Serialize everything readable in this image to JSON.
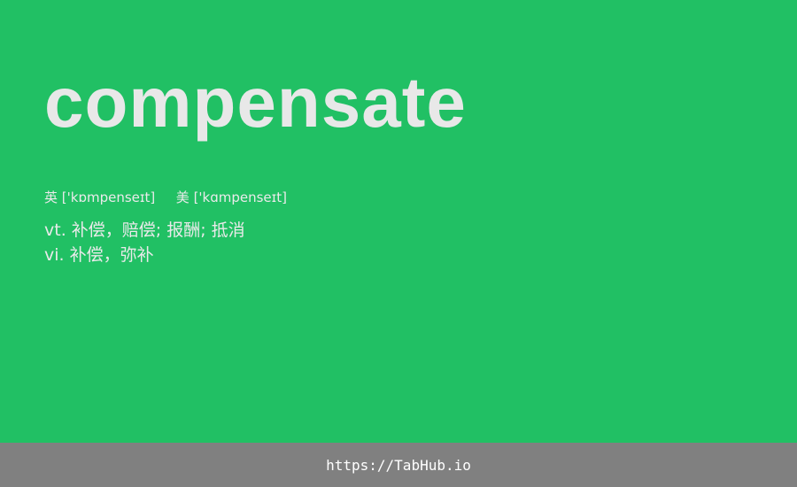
{
  "entry": {
    "word": "compensate",
    "phonetic_uk_label": "英",
    "phonetic_uk": "['kɒmpenseɪt]",
    "phonetic_us_label": "美",
    "phonetic_us": "['kɑmpenseɪt]",
    "definitions": [
      {
        "pos": "vt.",
        "meaning": "补偿，赔偿; 报酬; 抵消"
      },
      {
        "pos": "vi.",
        "meaning": "补偿，弥补"
      }
    ]
  },
  "footer": {
    "link_text": "https://TabHub.io"
  },
  "colors": {
    "background": "#21c064",
    "footer_bg": "#808080",
    "text": "#e8e8e8"
  }
}
